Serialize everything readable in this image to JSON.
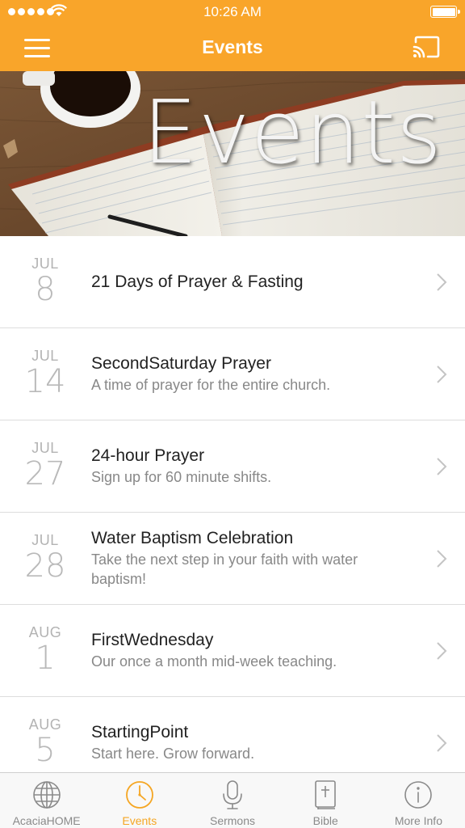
{
  "status_bar": {
    "time": "10:26 AM"
  },
  "nav": {
    "title": "Events"
  },
  "hero": {
    "title": "Events"
  },
  "events": [
    {
      "month": "JUL",
      "day": "8",
      "title": "21 Days of Prayer & Fasting",
      "subtitle": ""
    },
    {
      "month": "JUL",
      "day": "14",
      "title": "SecondSaturday Prayer",
      "subtitle": "A time of prayer for the entire church."
    },
    {
      "month": "JUL",
      "day": "27",
      "title": "24-hour Prayer",
      "subtitle": "Sign up for 60 minute shifts."
    },
    {
      "month": "JUL",
      "day": "28",
      "title": "Water Baptism Celebration",
      "subtitle": "Take the next step in your faith with water baptism!"
    },
    {
      "month": "AUG",
      "day": "1",
      "title": "FirstWednesday",
      "subtitle": "Our once a month mid-week teaching."
    },
    {
      "month": "AUG",
      "day": "5",
      "title": "StartingPoint",
      "subtitle": "Start here. Grow forward."
    }
  ],
  "tabs": [
    {
      "label": "AcaciaHOME",
      "icon": "globe-icon",
      "active": false
    },
    {
      "label": "Events",
      "icon": "clock-icon",
      "active": true
    },
    {
      "label": "Sermons",
      "icon": "microphone-icon",
      "active": false
    },
    {
      "label": "Bible",
      "icon": "bible-icon",
      "active": false
    },
    {
      "label": "More Info",
      "icon": "info-icon",
      "active": false
    }
  ],
  "colors": {
    "accent": "#F9A52A",
    "tab_active": "#F5A623",
    "tab_inactive": "#8A8A8A"
  }
}
